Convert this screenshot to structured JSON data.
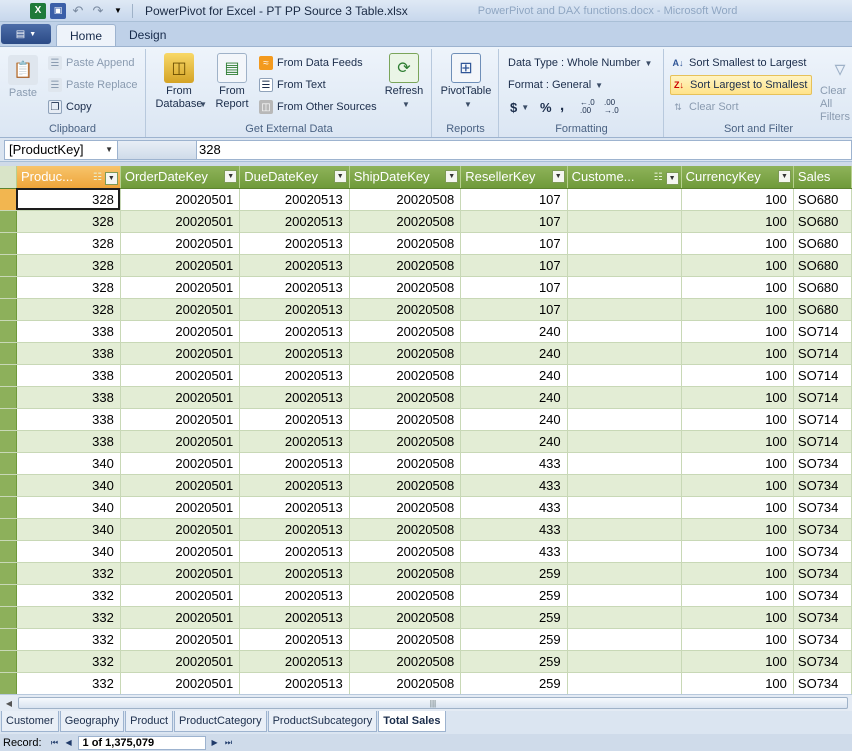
{
  "window": {
    "title": "PowerPivot for Excel - PT PP Source 3 Table.xlsx",
    "background_title": "PowerPivot and DAX functions.docx - Microsoft Word"
  },
  "ribbon_tabs": [
    "Home",
    "Design"
  ],
  "ribbon": {
    "clipboard": {
      "label": "Clipboard",
      "paste": "Paste",
      "paste_append": "Paste Append",
      "paste_replace": "Paste Replace",
      "copy": "Copy"
    },
    "external": {
      "label": "Get External Data",
      "from_database": "From Database",
      "from_report": "From Report",
      "from_data_feeds": "From Data Feeds",
      "from_text": "From Text",
      "from_other_sources": "From Other Sources",
      "refresh": "Refresh"
    },
    "reports": {
      "label": "Reports",
      "pivottable": "PivotTable"
    },
    "formatting": {
      "label": "Formatting",
      "data_type": "Data Type : Whole Number",
      "format": "Format : General",
      "currency": "$",
      "percent": "%",
      "comma": ",",
      "inc_decimal": "←.0 .00",
      "dec_decimal": ".00 →.0"
    },
    "sort_filter": {
      "label": "Sort and Filter",
      "sort_asc": "Sort Smallest to Largest",
      "sort_desc": "Sort Largest to Smallest",
      "clear_sort": "Clear Sort",
      "clear_all_filters": "Clear All Filters"
    }
  },
  "formula_bar": {
    "name_box": "[ProductKey]",
    "value": "328"
  },
  "columns": [
    "Produc...",
    "OrderDateKey",
    "DueDateKey",
    "ShipDateKey",
    "ResellerKey",
    "Custome...",
    "CurrencyKey",
    "Sales"
  ],
  "rows": [
    [
      "328",
      "20020501",
      "20020513",
      "20020508",
      "107",
      "",
      "100",
      "SO680"
    ],
    [
      "328",
      "20020501",
      "20020513",
      "20020508",
      "107",
      "",
      "100",
      "SO680"
    ],
    [
      "328",
      "20020501",
      "20020513",
      "20020508",
      "107",
      "",
      "100",
      "SO680"
    ],
    [
      "328",
      "20020501",
      "20020513",
      "20020508",
      "107",
      "",
      "100",
      "SO680"
    ],
    [
      "328",
      "20020501",
      "20020513",
      "20020508",
      "107",
      "",
      "100",
      "SO680"
    ],
    [
      "328",
      "20020501",
      "20020513",
      "20020508",
      "107",
      "",
      "100",
      "SO680"
    ],
    [
      "338",
      "20020501",
      "20020513",
      "20020508",
      "240",
      "",
      "100",
      "SO714"
    ],
    [
      "338",
      "20020501",
      "20020513",
      "20020508",
      "240",
      "",
      "100",
      "SO714"
    ],
    [
      "338",
      "20020501",
      "20020513",
      "20020508",
      "240",
      "",
      "100",
      "SO714"
    ],
    [
      "338",
      "20020501",
      "20020513",
      "20020508",
      "240",
      "",
      "100",
      "SO714"
    ],
    [
      "338",
      "20020501",
      "20020513",
      "20020508",
      "240",
      "",
      "100",
      "SO714"
    ],
    [
      "338",
      "20020501",
      "20020513",
      "20020508",
      "240",
      "",
      "100",
      "SO714"
    ],
    [
      "340",
      "20020501",
      "20020513",
      "20020508",
      "433",
      "",
      "100",
      "SO734"
    ],
    [
      "340",
      "20020501",
      "20020513",
      "20020508",
      "433",
      "",
      "100",
      "SO734"
    ],
    [
      "340",
      "20020501",
      "20020513",
      "20020508",
      "433",
      "",
      "100",
      "SO734"
    ],
    [
      "340",
      "20020501",
      "20020513",
      "20020508",
      "433",
      "",
      "100",
      "SO734"
    ],
    [
      "340",
      "20020501",
      "20020513",
      "20020508",
      "433",
      "",
      "100",
      "SO734"
    ],
    [
      "332",
      "20020501",
      "20020513",
      "20020508",
      "259",
      "",
      "100",
      "SO734"
    ],
    [
      "332",
      "20020501",
      "20020513",
      "20020508",
      "259",
      "",
      "100",
      "SO734"
    ],
    [
      "332",
      "20020501",
      "20020513",
      "20020508",
      "259",
      "",
      "100",
      "SO734"
    ],
    [
      "332",
      "20020501",
      "20020513",
      "20020508",
      "259",
      "",
      "100",
      "SO734"
    ],
    [
      "332",
      "20020501",
      "20020513",
      "20020508",
      "259",
      "",
      "100",
      "SO734"
    ],
    [
      "332",
      "20020501",
      "20020513",
      "20020508",
      "259",
      "",
      "100",
      "SO734"
    ]
  ],
  "sheet_tabs": [
    "Customer",
    "Geography",
    "Product",
    "ProductCategory",
    "ProductSubcategory",
    "Total Sales"
  ],
  "active_sheet": "Total Sales",
  "record_bar": {
    "label": "Record:",
    "position": "1 of 1,375,079"
  },
  "colors": {
    "header_green": "#7ba446",
    "selected_header": "#f0ab42",
    "row_alt": "#e3edd5"
  }
}
